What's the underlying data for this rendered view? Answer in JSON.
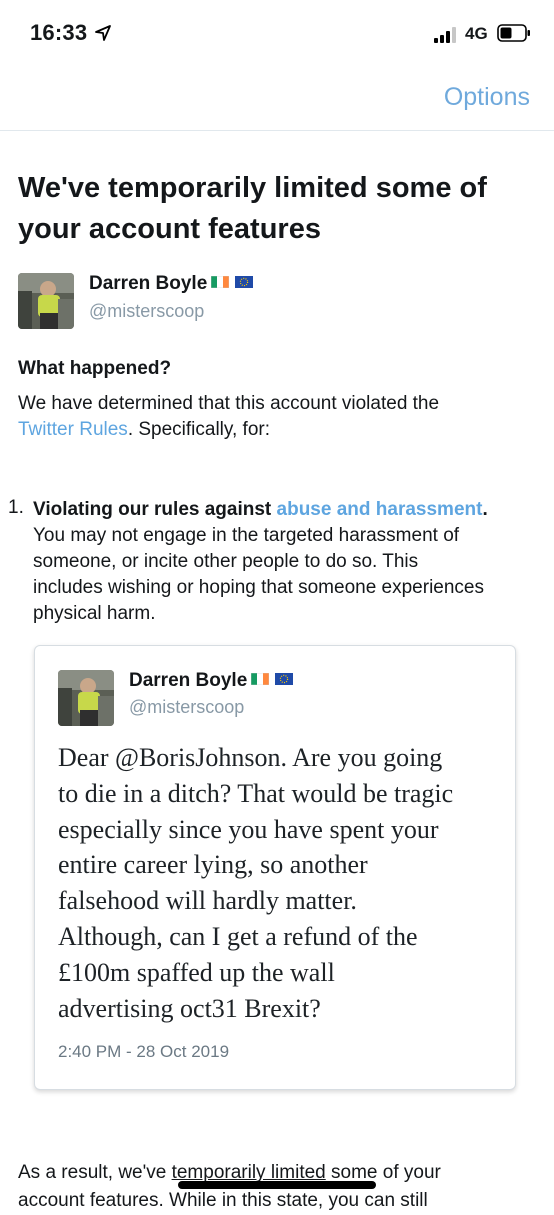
{
  "status_bar": {
    "time": "16:33",
    "network": "4G"
  },
  "nav": {
    "options_label": "Options"
  },
  "notice": {
    "title": "We've temporarily limited some of your account features"
  },
  "user": {
    "name": "Darren Boyle",
    "handle": "@misterscoop"
  },
  "what_happened": {
    "heading": "What happened?",
    "line1": "We have determined that this account violated the",
    "rules_link": "Twitter Rules",
    "line2_suffix": ". Specifically, for:"
  },
  "violation": {
    "number": "1.",
    "heading_prefix": "Violating our rules against ",
    "heading_link": "abuse and harassment",
    "heading_suffix": ".",
    "lines": [
      "You may not engage in the targeted harassment of",
      "someone, or incite other people to do so. This",
      "includes wishing or hoping that someone experiences",
      "physical harm."
    ]
  },
  "tweet": {
    "name": "Darren Boyle",
    "handle": "@misterscoop",
    "lines": [
      "Dear @BorisJohnson. Are you going",
      "to die in a ditch? That would be tragic",
      "especially since you have spent your",
      "entire career lying, so another",
      "falsehood will hardly matter.",
      "Although, can I get a refund of the",
      "£100m spaffed up the wall",
      "advertising oct31 Brexit?"
    ],
    "timestamp": "2:40 PM - 28 Oct 2019"
  },
  "result": {
    "line1_prefix": "As a result, we've ",
    "line1_underlined": "temporarily limited",
    "line1_suffix": " some of your",
    "line2": "account features. While in this state, you can still"
  },
  "colors": {
    "link": "#5ea5e0",
    "options": "#6fa9dc",
    "secondary": "#8899a6"
  }
}
